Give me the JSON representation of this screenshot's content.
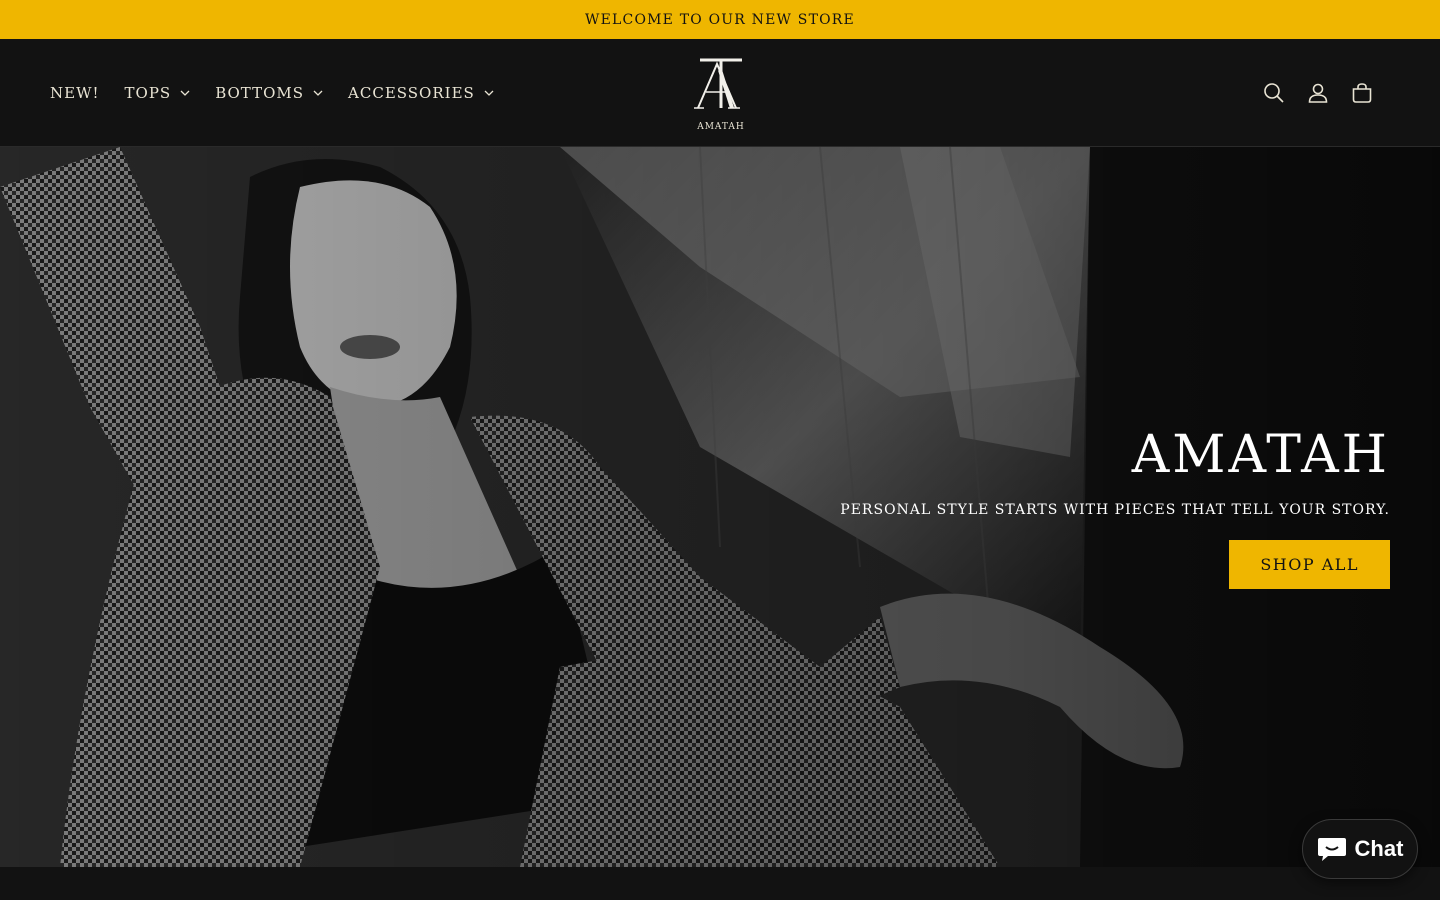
{
  "announcement": {
    "text": "WELCOME TO OUR NEW STORE"
  },
  "header": {
    "nav": [
      {
        "label": "NEW!",
        "has_dropdown": false
      },
      {
        "label": "TOPS",
        "has_dropdown": true
      },
      {
        "label": "BOTTOMS",
        "has_dropdown": true
      },
      {
        "label": "ACCESSORIES",
        "has_dropdown": true
      }
    ],
    "logo_text": "AMATAH",
    "icons": [
      "search-icon",
      "account-icon",
      "cart-icon"
    ]
  },
  "hero": {
    "title": "AMATAH",
    "subtitle": "PERSONAL STYLE STARTS WITH PIECES THAT TELL YOUR STORY.",
    "button_label": "SHOP ALL"
  },
  "chat": {
    "label": "Chat",
    "icon": "chat-bubble-icon"
  },
  "colors": {
    "accent": "#efb600",
    "background": "#121212",
    "nav_text": "#e9e4d4"
  }
}
